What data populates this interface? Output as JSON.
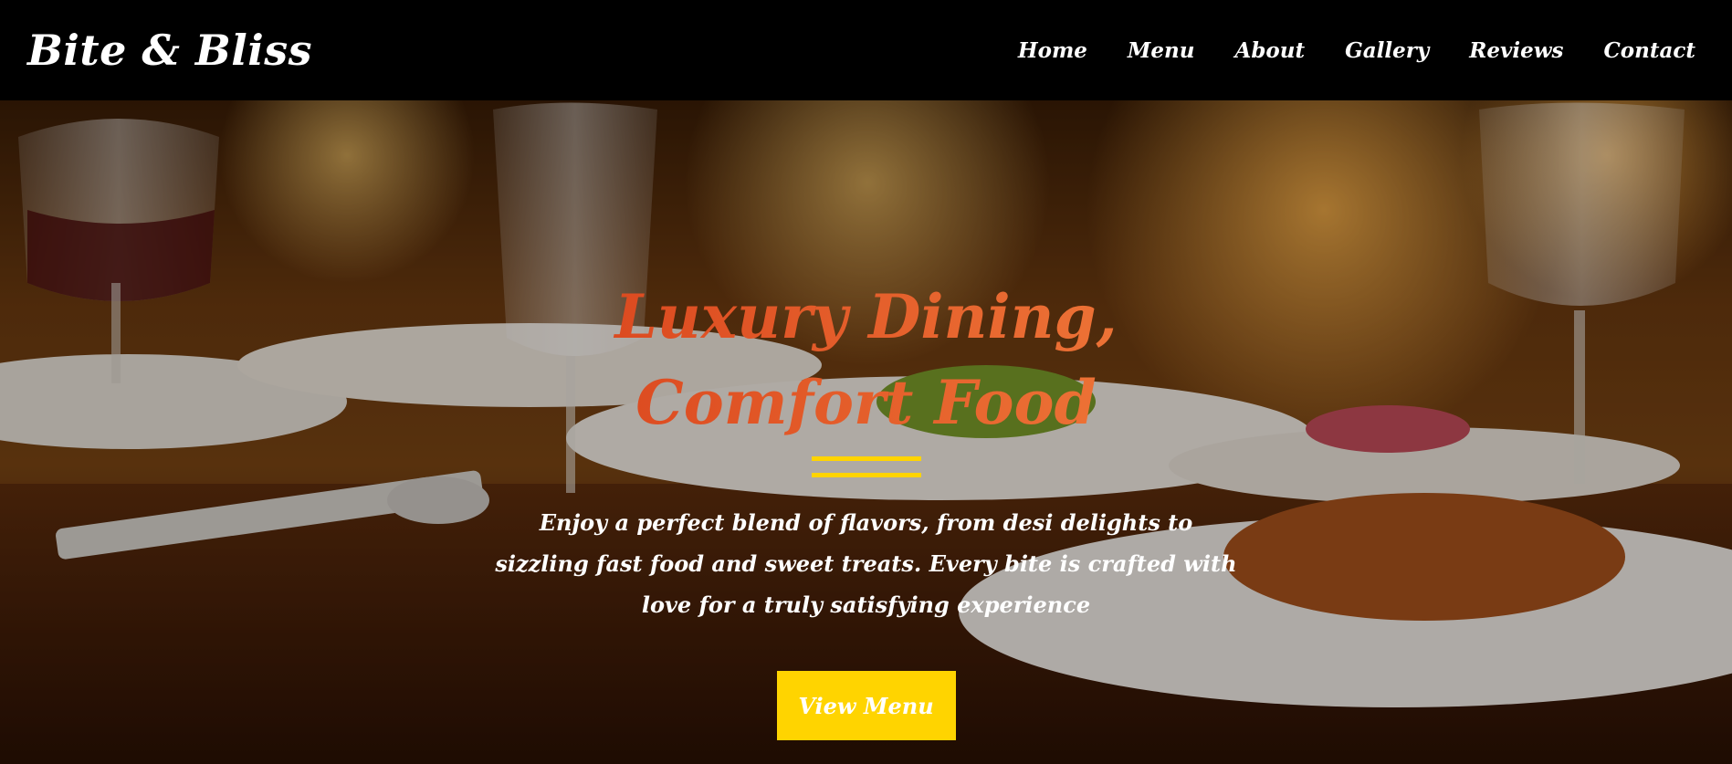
{
  "brand": {
    "name": "Bite & Bliss"
  },
  "nav": {
    "items": [
      {
        "label": "Home"
      },
      {
        "label": "Menu"
      },
      {
        "label": "About"
      },
      {
        "label": "Gallery"
      },
      {
        "label": "Reviews"
      },
      {
        "label": "Contact"
      }
    ]
  },
  "hero": {
    "title": "Luxury Dining, Comfort Food",
    "description": "Enjoy a perfect blend of flavors, from desi delights to sizzling fast food and sweet treats. Every bite is crafted with love for a truly satisfying experience",
    "cta_label": "View Menu",
    "background_image": "restaurant-table-photo"
  },
  "colors": {
    "accent": "#ffd400",
    "title_gradient_start": "#d9431c",
    "title_gradient_end": "#f07a3a",
    "navbar": "#000000"
  }
}
